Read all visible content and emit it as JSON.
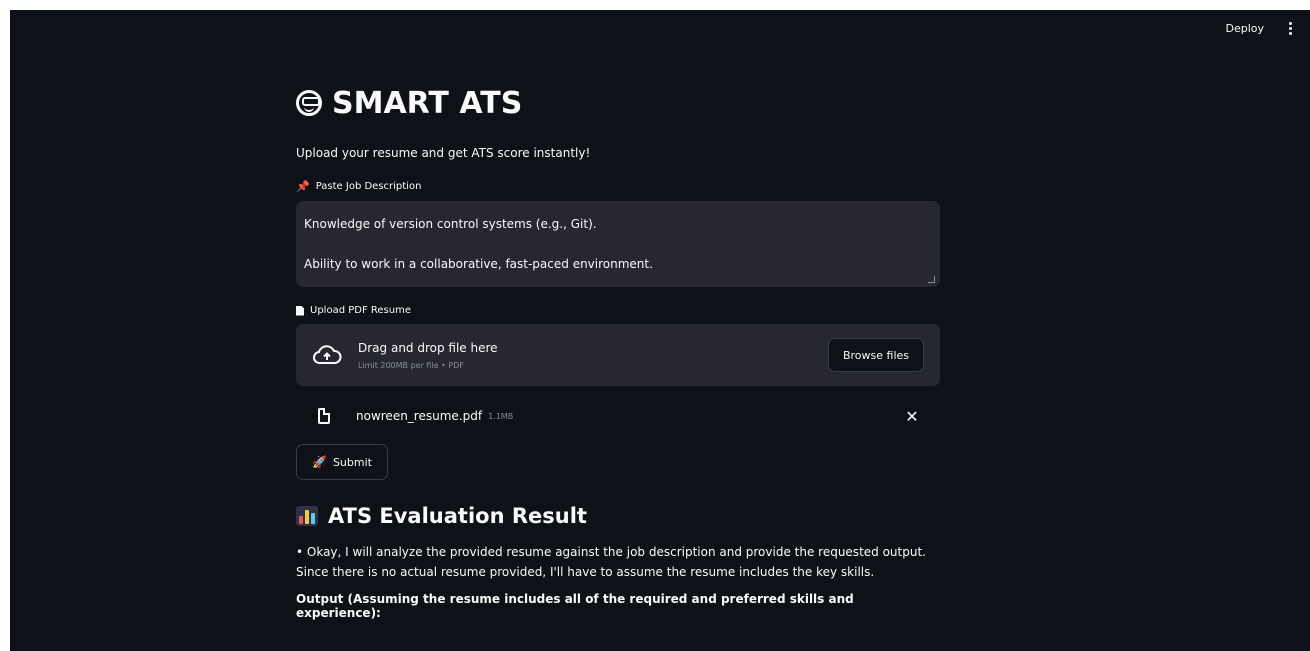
{
  "topbar": {
    "deploy_label": "Deploy",
    "menu_icon": "more-vertical-icon"
  },
  "header": {
    "title": "SMART ATS",
    "title_icon": "grinning-face-icon",
    "subtitle": "Upload your resume and get ATS score instantly!"
  },
  "job_description": {
    "label": "Paste Job Description",
    "label_icon": "pushpin-icon",
    "lines": [
      "Knowledge of version control systems (e.g., Git).",
      "Ability to work in a collaborative, fast-paced environment."
    ]
  },
  "upload": {
    "label": "Upload PDF Resume",
    "label_icon": "page-icon",
    "drop_title": "Drag and drop file here",
    "drop_limit": "Limit 200MB per file • PDF",
    "browse_label": "Browse files",
    "file": {
      "name": "nowreen_resume.pdf",
      "size": "1.1MB"
    }
  },
  "submit": {
    "label": "Submit",
    "icon": "rocket-icon"
  },
  "result": {
    "title": "ATS Evaluation Result",
    "title_icon": "bar-chart-icon",
    "line1": "• Okay, I will analyze the provided resume against the job description and provide the requested output.",
    "line2": "Since there is no actual resume provided, I'll have to assume the resume includes the key skills.",
    "output_heading": "Output (Assuming the resume includes all of the required and preferred skills and experience):"
  },
  "colors": {
    "background": "#0e1117",
    "input_bg": "#262730",
    "text": "#fafafa",
    "accent": "#ff4b4b"
  }
}
